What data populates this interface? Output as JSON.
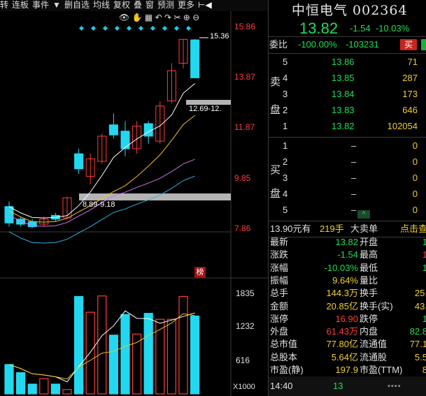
{
  "toolbar": {
    "items": [
      "转",
      "连板",
      "事件",
      "▼",
      "删自选",
      "均线",
      "复权",
      "叠",
      "窗",
      "预测",
      "更多"
    ]
  },
  "chart": {
    "price_labels": [
      "15.86",
      "13.87",
      "11.87",
      "9.85",
      "7.86"
    ],
    "volume_labels": [
      "1835",
      "1232",
      "616",
      "X1000"
    ],
    "high_marker": "15.36",
    "annot_upper": "12.69-12.",
    "annot_lower": "8.89-9.18",
    "badge": "榜",
    "chart_data": {
      "type": "candlestick",
      "candles": [
        {
          "o": 8.05,
          "c": 8.7,
          "h": 8.9,
          "l": 7.9,
          "up": false
        },
        {
          "o": 8.0,
          "c": 8.2,
          "h": 8.3,
          "l": 7.9,
          "up": false
        },
        {
          "o": 8.1,
          "c": 7.9,
          "h": 8.2,
          "l": 7.85,
          "up": false
        },
        {
          "o": 8.0,
          "c": 8.2,
          "h": 8.3,
          "l": 7.9,
          "up": true
        },
        {
          "o": 8.2,
          "c": 8.35,
          "h": 8.45,
          "l": 8.1,
          "up": false
        },
        {
          "o": 8.25,
          "c": 9.05,
          "h": 9.1,
          "l": 8.2,
          "up": true
        },
        {
          "o": 10.8,
          "c": 10.2,
          "h": 11.0,
          "l": 10.0,
          "up": false
        },
        {
          "o": 9.9,
          "c": 10.6,
          "h": 10.8,
          "l": 9.6,
          "up": true
        },
        {
          "o": 10.5,
          "c": 11.5,
          "h": 11.6,
          "l": 10.4,
          "up": true
        },
        {
          "o": 11.55,
          "c": 11.95,
          "h": 12.4,
          "l": 11.4,
          "up": false
        },
        {
          "o": 11.7,
          "c": 11.0,
          "h": 12.1,
          "l": 10.7,
          "up": false
        },
        {
          "o": 11.0,
          "c": 11.9,
          "h": 12.1,
          "l": 10.8,
          "up": true
        },
        {
          "o": 11.5,
          "c": 12.0,
          "h": 12.1,
          "l": 11.2,
          "up": false
        },
        {
          "o": 11.3,
          "c": 12.7,
          "h": 12.9,
          "l": 11.2,
          "up": true
        },
        {
          "o": 12.9,
          "c": 14.1,
          "h": 14.4,
          "l": 12.8,
          "up": true
        },
        {
          "o": 14.4,
          "c": 15.35,
          "h": 15.36,
          "l": 14.2,
          "up": true
        },
        {
          "o": 15.33,
          "c": 13.82,
          "h": 15.36,
          "l": 13.8,
          "up": false
        }
      ],
      "volumes": [
        {
          "v": 540,
          "up": false
        },
        {
          "v": 390,
          "up": false
        },
        {
          "v": 180,
          "up": false
        },
        {
          "v": 280,
          "up": true
        },
        {
          "v": 180,
          "up": false
        },
        {
          "v": 80,
          "up": true
        },
        {
          "v": 1790,
          "up": false
        },
        {
          "v": 1500,
          "up": true
        },
        {
          "v": 1800,
          "up": true
        },
        {
          "v": 1080,
          "up": false
        },
        {
          "v": 1460,
          "up": false
        },
        {
          "v": 1100,
          "up": true
        },
        {
          "v": 1480,
          "up": false
        },
        {
          "v": 1370,
          "up": true
        },
        {
          "v": 1370,
          "up": true
        },
        {
          "v": 1790,
          "up": true
        },
        {
          "v": 1430,
          "up": false
        }
      ],
      "ylim": [
        7.86,
        15.86
      ],
      "vol_ylim": [
        0,
        1835
      ]
    }
  },
  "quote": {
    "title": "中恒电气 002364",
    "price": "13.82",
    "change": "-1.54",
    "change_pct": "-10.03%",
    "weibi_label": "委比",
    "weibi_pct": "-100.00%",
    "weibi_val": "-103231",
    "buy_btn": "买",
    "sell_side_label": [
      "卖",
      "盘"
    ],
    "buy_side_label": [
      "买",
      "盘"
    ],
    "asks": [
      {
        "level": "5",
        "price": "13.86",
        "vol": "71"
      },
      {
        "level": "4",
        "price": "13.85",
        "vol": "287"
      },
      {
        "level": "3",
        "price": "13.84",
        "vol": "173"
      },
      {
        "level": "2",
        "price": "13.83",
        "vol": "646"
      },
      {
        "level": "1",
        "price": "13.82",
        "vol": "102054"
      }
    ],
    "bids": [
      {
        "level": "1",
        "price": "–",
        "vol": "0"
      },
      {
        "level": "2",
        "price": "–",
        "vol": "0"
      },
      {
        "level": "3",
        "price": "–",
        "vol": "0"
      },
      {
        "level": "4",
        "price": "–",
        "vol": "0"
      },
      {
        "level": "5",
        "price": "–",
        "vol": "0"
      }
    ],
    "bigorder": {
      "price": "13.90元有",
      "lots": "219手",
      "label": "大卖单",
      "link": "点击查"
    },
    "stats_left": [
      {
        "k": "最新",
        "v": "13.82",
        "c": "g"
      },
      {
        "k": "涨跌",
        "v": "-1.54",
        "c": "g"
      },
      {
        "k": "涨幅",
        "v": "-10.03%",
        "c": "g"
      },
      {
        "k": "振幅",
        "v": "9.64%",
        "c": "y"
      },
      {
        "k": "总手",
        "v": "144.3万",
        "c": "y"
      },
      {
        "k": "金额",
        "v": "20.85亿",
        "c": "y"
      },
      {
        "k": "涨停",
        "v": "16.90",
        "c": "r"
      },
      {
        "k": "外盘",
        "v": "61.43万",
        "c": "r"
      },
      {
        "k": "总市值",
        "v": "77.80亿",
        "c": "y"
      },
      {
        "k": "总股本",
        "v": "5.64亿",
        "c": "y"
      },
      {
        "k": "市盈(静)",
        "v": "197.9",
        "c": "y"
      }
    ],
    "stats_right": [
      {
        "k": "开盘",
        "v": "1",
        "c": "g"
      },
      {
        "k": "最高",
        "v": "1",
        "c": "r"
      },
      {
        "k": "最低",
        "v": "1",
        "c": "g"
      },
      {
        "k": "量比",
        "v": "",
        "c": "y"
      },
      {
        "k": "换手",
        "v": "25.",
        "c": "y"
      },
      {
        "k": "换手(实)",
        "v": "43.",
        "c": "y"
      },
      {
        "k": "跌停",
        "v": "1",
        "c": "g"
      },
      {
        "k": "内盘",
        "v": "82.8",
        "c": "g"
      },
      {
        "k": "流通值",
        "v": "77.1",
        "c": "y"
      },
      {
        "k": "流通股",
        "v": "5.5",
        "c": "y"
      },
      {
        "k": "市盈(TTM)",
        "v": "8",
        "c": "y"
      }
    ],
    "tick_time": "14:40",
    "tick_price": "13"
  },
  "colors": {
    "up": "#ff3b3b",
    "down": "#22d8f0",
    "ma5": "#ffffff",
    "ma10": "#f0c020",
    "ma20": "#d070f0",
    "ma60": "#30b0e0"
  }
}
